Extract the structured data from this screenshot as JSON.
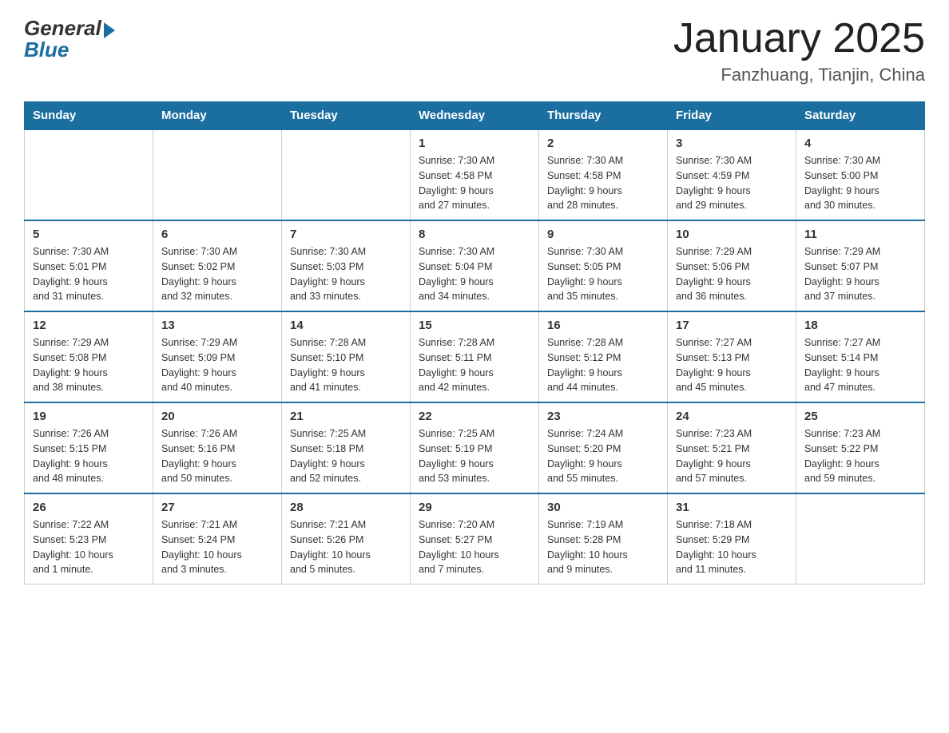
{
  "header": {
    "logo_general": "General",
    "logo_blue": "Blue",
    "title": "January 2025",
    "location": "Fanzhuang, Tianjin, China"
  },
  "days_of_week": [
    "Sunday",
    "Monday",
    "Tuesday",
    "Wednesday",
    "Thursday",
    "Friday",
    "Saturday"
  ],
  "weeks": [
    [
      {
        "day": "",
        "info": ""
      },
      {
        "day": "",
        "info": ""
      },
      {
        "day": "",
        "info": ""
      },
      {
        "day": "1",
        "info": "Sunrise: 7:30 AM\nSunset: 4:58 PM\nDaylight: 9 hours\nand 27 minutes."
      },
      {
        "day": "2",
        "info": "Sunrise: 7:30 AM\nSunset: 4:58 PM\nDaylight: 9 hours\nand 28 minutes."
      },
      {
        "day": "3",
        "info": "Sunrise: 7:30 AM\nSunset: 4:59 PM\nDaylight: 9 hours\nand 29 minutes."
      },
      {
        "day": "4",
        "info": "Sunrise: 7:30 AM\nSunset: 5:00 PM\nDaylight: 9 hours\nand 30 minutes."
      }
    ],
    [
      {
        "day": "5",
        "info": "Sunrise: 7:30 AM\nSunset: 5:01 PM\nDaylight: 9 hours\nand 31 minutes."
      },
      {
        "day": "6",
        "info": "Sunrise: 7:30 AM\nSunset: 5:02 PM\nDaylight: 9 hours\nand 32 minutes."
      },
      {
        "day": "7",
        "info": "Sunrise: 7:30 AM\nSunset: 5:03 PM\nDaylight: 9 hours\nand 33 minutes."
      },
      {
        "day": "8",
        "info": "Sunrise: 7:30 AM\nSunset: 5:04 PM\nDaylight: 9 hours\nand 34 minutes."
      },
      {
        "day": "9",
        "info": "Sunrise: 7:30 AM\nSunset: 5:05 PM\nDaylight: 9 hours\nand 35 minutes."
      },
      {
        "day": "10",
        "info": "Sunrise: 7:29 AM\nSunset: 5:06 PM\nDaylight: 9 hours\nand 36 minutes."
      },
      {
        "day": "11",
        "info": "Sunrise: 7:29 AM\nSunset: 5:07 PM\nDaylight: 9 hours\nand 37 minutes."
      }
    ],
    [
      {
        "day": "12",
        "info": "Sunrise: 7:29 AM\nSunset: 5:08 PM\nDaylight: 9 hours\nand 38 minutes."
      },
      {
        "day": "13",
        "info": "Sunrise: 7:29 AM\nSunset: 5:09 PM\nDaylight: 9 hours\nand 40 minutes."
      },
      {
        "day": "14",
        "info": "Sunrise: 7:28 AM\nSunset: 5:10 PM\nDaylight: 9 hours\nand 41 minutes."
      },
      {
        "day": "15",
        "info": "Sunrise: 7:28 AM\nSunset: 5:11 PM\nDaylight: 9 hours\nand 42 minutes."
      },
      {
        "day": "16",
        "info": "Sunrise: 7:28 AM\nSunset: 5:12 PM\nDaylight: 9 hours\nand 44 minutes."
      },
      {
        "day": "17",
        "info": "Sunrise: 7:27 AM\nSunset: 5:13 PM\nDaylight: 9 hours\nand 45 minutes."
      },
      {
        "day": "18",
        "info": "Sunrise: 7:27 AM\nSunset: 5:14 PM\nDaylight: 9 hours\nand 47 minutes."
      }
    ],
    [
      {
        "day": "19",
        "info": "Sunrise: 7:26 AM\nSunset: 5:15 PM\nDaylight: 9 hours\nand 48 minutes."
      },
      {
        "day": "20",
        "info": "Sunrise: 7:26 AM\nSunset: 5:16 PM\nDaylight: 9 hours\nand 50 minutes."
      },
      {
        "day": "21",
        "info": "Sunrise: 7:25 AM\nSunset: 5:18 PM\nDaylight: 9 hours\nand 52 minutes."
      },
      {
        "day": "22",
        "info": "Sunrise: 7:25 AM\nSunset: 5:19 PM\nDaylight: 9 hours\nand 53 minutes."
      },
      {
        "day": "23",
        "info": "Sunrise: 7:24 AM\nSunset: 5:20 PM\nDaylight: 9 hours\nand 55 minutes."
      },
      {
        "day": "24",
        "info": "Sunrise: 7:23 AM\nSunset: 5:21 PM\nDaylight: 9 hours\nand 57 minutes."
      },
      {
        "day": "25",
        "info": "Sunrise: 7:23 AM\nSunset: 5:22 PM\nDaylight: 9 hours\nand 59 minutes."
      }
    ],
    [
      {
        "day": "26",
        "info": "Sunrise: 7:22 AM\nSunset: 5:23 PM\nDaylight: 10 hours\nand 1 minute."
      },
      {
        "day": "27",
        "info": "Sunrise: 7:21 AM\nSunset: 5:24 PM\nDaylight: 10 hours\nand 3 minutes."
      },
      {
        "day": "28",
        "info": "Sunrise: 7:21 AM\nSunset: 5:26 PM\nDaylight: 10 hours\nand 5 minutes."
      },
      {
        "day": "29",
        "info": "Sunrise: 7:20 AM\nSunset: 5:27 PM\nDaylight: 10 hours\nand 7 minutes."
      },
      {
        "day": "30",
        "info": "Sunrise: 7:19 AM\nSunset: 5:28 PM\nDaylight: 10 hours\nand 9 minutes."
      },
      {
        "day": "31",
        "info": "Sunrise: 7:18 AM\nSunset: 5:29 PM\nDaylight: 10 hours\nand 11 minutes."
      },
      {
        "day": "",
        "info": ""
      }
    ]
  ]
}
